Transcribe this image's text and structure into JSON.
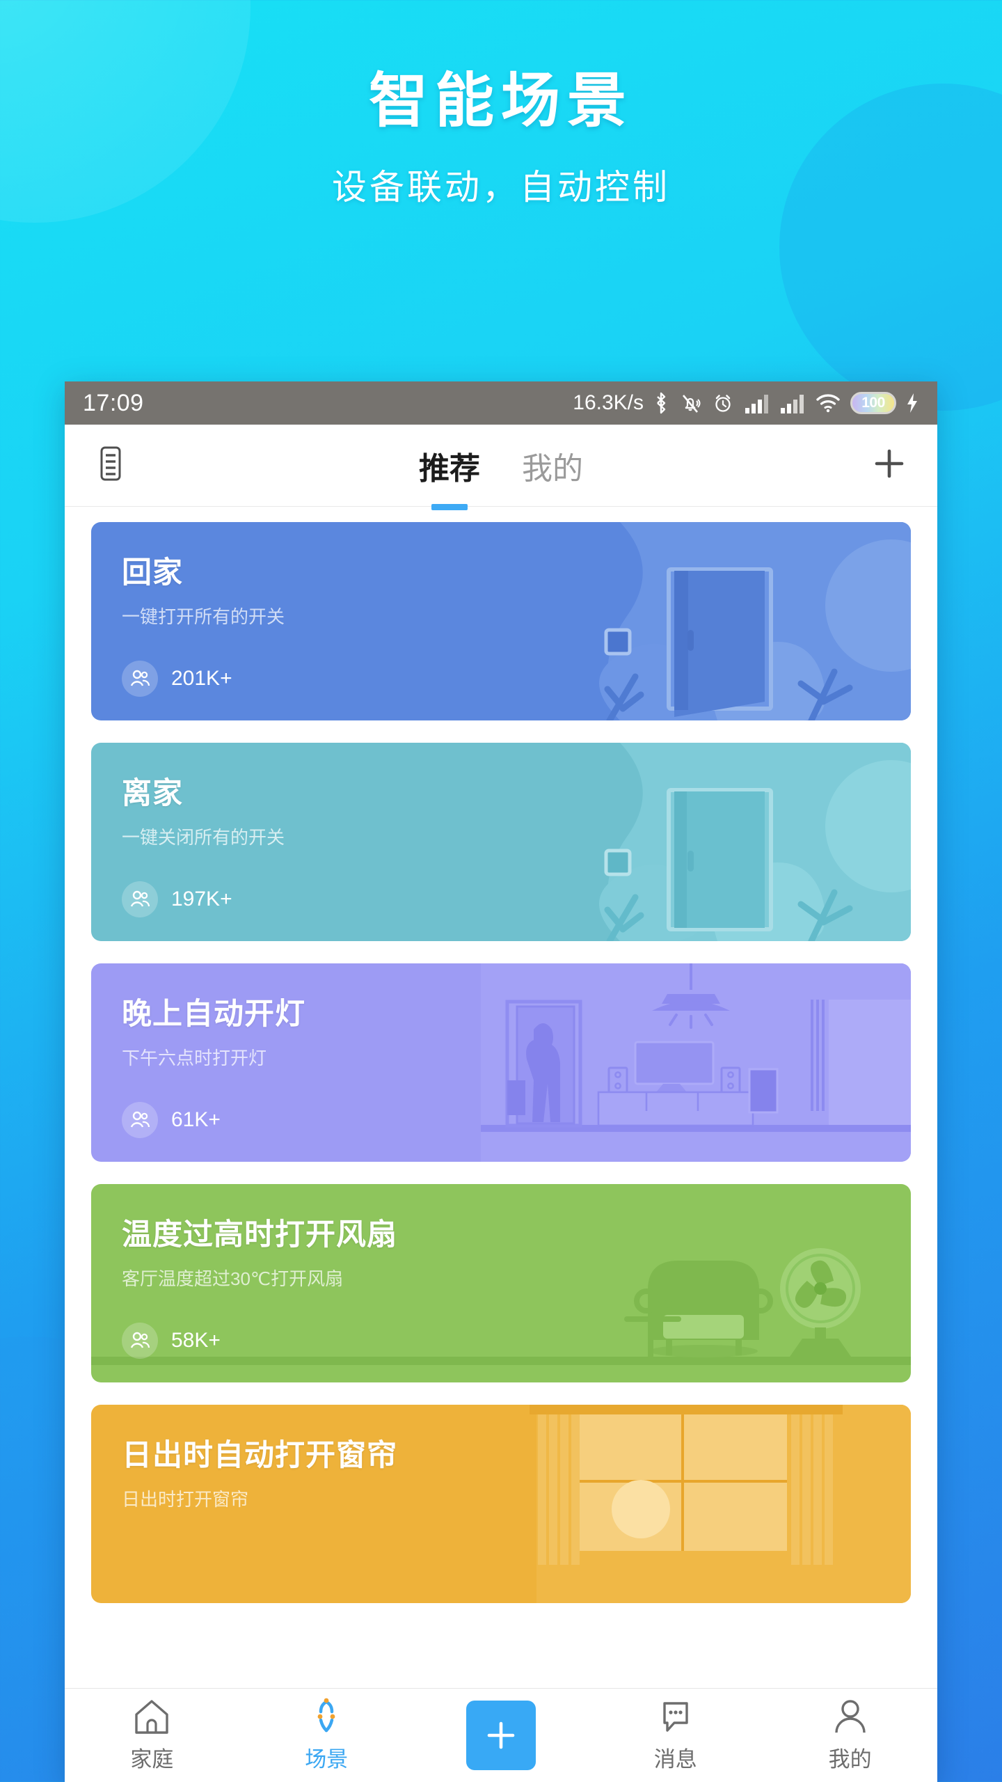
{
  "promo": {
    "title": "智能场景",
    "subtitle": "设备联动，自动控制"
  },
  "statusbar": {
    "time": "17:09",
    "network_speed": "16.3K/s",
    "battery_level": "100",
    "icons": [
      "bluetooth-icon",
      "silent-bell-icon",
      "alarm-clock-icon",
      "signal-bars-icon",
      "signal-bars-2-icon",
      "wifi-icon",
      "battery-icon",
      "charging-bolt-icon"
    ]
  },
  "topbar": {
    "menu_icon": "list-menu-icon",
    "add_icon": "plus-icon",
    "tabs": [
      {
        "label": "推荐",
        "active": true
      },
      {
        "label": "我的",
        "active": false
      }
    ]
  },
  "scenes": [
    {
      "title": "回家",
      "subtitle": "一键打开所有的开关",
      "count": "201K+",
      "color": "#5b87de",
      "art": "door-open-illustration"
    },
    {
      "title": "离家",
      "subtitle": "一键关闭所有的开关",
      "count": "197K+",
      "color": "#6fc0ce",
      "art": "door-closed-illustration"
    },
    {
      "title": "晚上自动开灯",
      "subtitle": "下午六点时打开灯",
      "count": "61K+",
      "color": "#9d9bf4",
      "art": "living-room-illustration"
    },
    {
      "title": "温度过高时打开风扇",
      "subtitle": "客厅温度超过30℃打开风扇",
      "count": "58K+",
      "color": "#8ec55c",
      "art": "fan-sofa-illustration"
    },
    {
      "title": "日出时自动打开窗帘",
      "subtitle": "日出时打开窗帘",
      "count": "",
      "color": "#eeb23a",
      "art": "curtain-window-illustration"
    }
  ],
  "bottomnav": {
    "items": [
      {
        "label": "家庭",
        "icon": "home-icon",
        "active": false
      },
      {
        "label": "场景",
        "icon": "scene-diamond-icon",
        "active": true
      },
      {
        "label": "消息",
        "icon": "message-bubble-icon",
        "active": false
      },
      {
        "label": "我的",
        "icon": "person-icon",
        "active": false
      }
    ],
    "add_button_icon": "plus-icon"
  },
  "colors": {
    "accent": "#3ba7f2",
    "brand_gradient_start": "#18e0f5",
    "brand_gradient_end": "#2b7fe8"
  }
}
